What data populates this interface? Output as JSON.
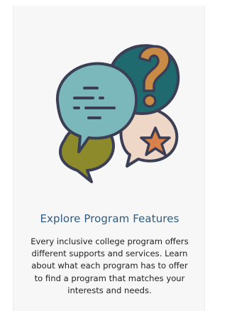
{
  "card": {
    "title": "Explore Program Features",
    "description_lines": [
      "Every inclusive college program offers",
      "different supports and services. Learn",
      "about what each program has to offer",
      "to find a program that matches your",
      "interests and needs."
    ],
    "illustration_icon": "speech-bubbles-question-star-icon"
  },
  "colors": {
    "title": "#2f5a82",
    "text": "#222222",
    "card_bg": "#f7f7f7",
    "bubble_teal_dark": "#1f6a6e",
    "bubble_teal_light": "#7bb8bb",
    "bubble_olive": "#8c8a2a",
    "bubble_peach": "#efd7c7",
    "question_mark": "#c98a45",
    "star": "#d9814a",
    "outline": "#3b3f55"
  }
}
